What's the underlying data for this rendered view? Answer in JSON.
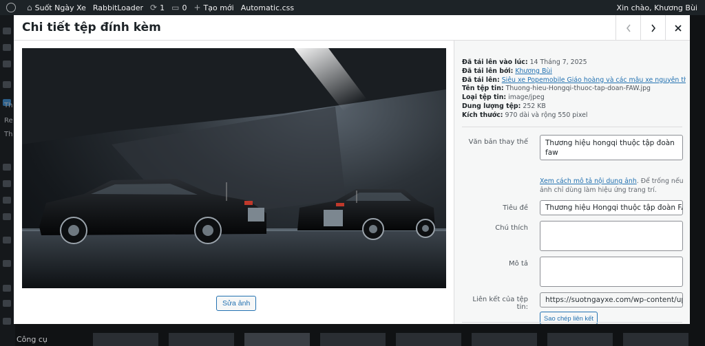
{
  "adminbar": {
    "site_name": "Suốt Ngày Xe",
    "plugin": "RabbitLoader",
    "updates_count": "1",
    "comments_count": "0",
    "new_label": "Tạo mới",
    "automatic_css": "Automatic.css",
    "greeting": "Xin chào, Khương Bùi"
  },
  "background": {
    "bottom_menu_label": "Công cụ",
    "side_labels": [
      "Th",
      "Re",
      "Th"
    ]
  },
  "modal": {
    "title": "Chi tiết tệp đính kèm",
    "prev_icon": "chevron-left-icon",
    "next_icon": "chevron-right-icon",
    "close_icon": "close-icon"
  },
  "image": {
    "alt": "Thương hiệu hongqi thuộc tập đoàn faw",
    "edit_label": "Sửa ảnh"
  },
  "meta": {
    "uploaded_on_label": "Đã tải lên vào lúc:",
    "uploaded_on_value": "14 Tháng 7, 2025",
    "uploaded_by_label": "Đã tải lên bởi:",
    "uploaded_by_value": "Khương Bùi",
    "uploaded_to_label": "Đã tải lên:",
    "uploaded_to_value": "Siêu xe Popemobile Giáo hoàng và các mẫu xe nguyên thủ",
    "filename_label": "Tên tệp tin:",
    "filename_value": "Thuong-hieu-Hongqi-thuoc-tap-doan-FAW.jpg",
    "filetype_label": "Loại tệp tin:",
    "filetype_value": "image/jpeg",
    "filesize_label": "Dung lượng tệp:",
    "filesize_value": "252 KB",
    "dimensions_label": "Kích thước:",
    "dimensions_value": "970 dài và rộng 550 pixel"
  },
  "fields": {
    "alt_label": "Văn bản thay thế",
    "alt_value": "Thương hiệu hongqi thuộc tập đoàn faw",
    "help_link": "Xem cách mô tả nội dung ảnh",
    "help_text": ". Để trống nếu ảnh chỉ dùng làm hiệu ứng trang trí.",
    "title_label": "Tiêu đề",
    "title_value": "Thương hiệu Hongqi thuộc tập đoàn FAW",
    "caption_label": "Chú thích",
    "caption_value": "",
    "description_label": "Mô tả",
    "description_value": "",
    "url_label": "Liên kết của tệp tin:",
    "url_value": "https://suotngayxe.com/wp-content/uploads/",
    "copy_label": "Sao chép liên kết"
  },
  "colors": {
    "accent": "#2271b1",
    "adminbar": "#1d2327"
  }
}
